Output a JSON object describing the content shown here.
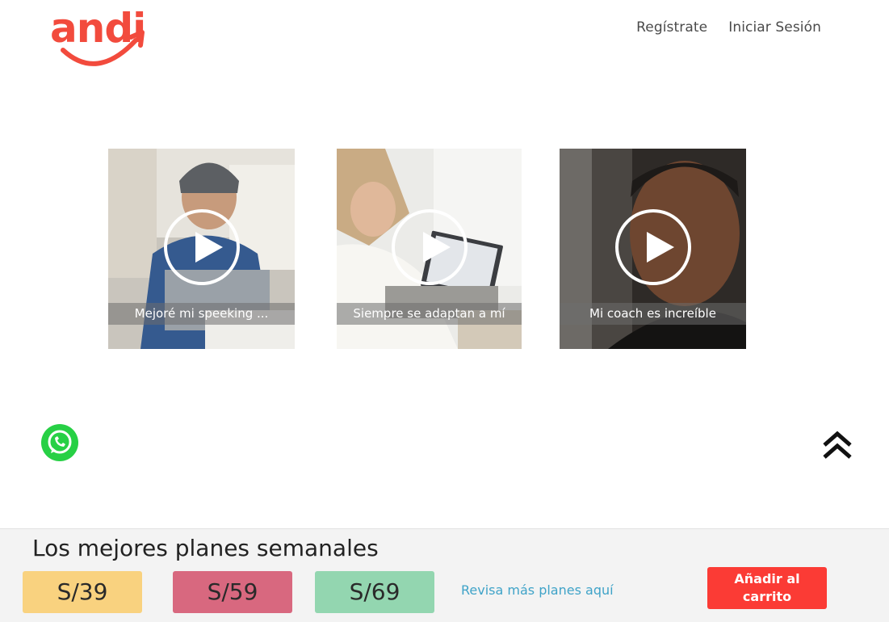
{
  "header": {
    "logo_text": "andi",
    "nav": {
      "register": "Regístrate",
      "login": "Iniciar Sesión"
    }
  },
  "testimonials": [
    {
      "caption": "Mejoré mi speeking ..."
    },
    {
      "caption": "Siempre se adaptan a mí"
    },
    {
      "caption": "Mi coach es increíble"
    }
  ],
  "icons": {
    "whatsapp": "whatsapp-icon",
    "scroll_top": "double-chevron-up-icon",
    "play": "play-icon"
  },
  "plans_bar": {
    "title": "Los mejores planes semanales",
    "plans": [
      {
        "price": "S/39",
        "color": "#f9d27f"
      },
      {
        "price": "S/59",
        "color": "#d8687f"
      },
      {
        "price": "S/69",
        "color": "#93d6b0"
      }
    ],
    "more_link": "Revisa más planes aquí",
    "add_to_cart": "Añadir al\ncarrito"
  },
  "colors": {
    "brand": "#f24b3d",
    "cart": "#fb3b35",
    "link": "#3fa3c8",
    "whatsapp": "#27d045"
  }
}
